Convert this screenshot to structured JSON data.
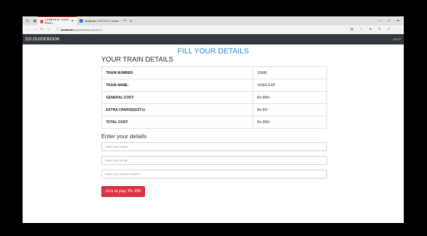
{
  "browser": {
    "tabs": [
      {
        "label": "COMPLETE YOUR PROC",
        "active": true
      },
      {
        "label": "localhost / 127.0.0.1 / trains",
        "active": false
      }
    ],
    "url_host": "localhost",
    "url_path": "/project/select.php?id=1"
  },
  "navbar": {
    "brand": "DS GUIDEBOOK",
    "help": "HELP"
  },
  "page": {
    "title": "FILL YOUR DETAILS",
    "train_heading": "YOUR TRAIN DETAILS",
    "rows": [
      {
        "label": "TRAIN NUMBER:",
        "value": "15906"
      },
      {
        "label": "TRAIN NAME:",
        "value": "VIVEK EXP"
      },
      {
        "label": "GENERAL COST:",
        "value": "Rs 300/-"
      },
      {
        "label": "EXTRA CHARGE(GST+):",
        "value": "Rs 50/-"
      },
      {
        "label": "TOTAL COST:",
        "value": "Rs 350/-"
      }
    ],
    "details_heading": "Enter your details",
    "fields": {
      "name_placeholder": "enter your name",
      "email_placeholder": "enter your email",
      "phone_placeholder": "enter your phone number"
    },
    "pay_button": "click to pay: Rs 350"
  }
}
